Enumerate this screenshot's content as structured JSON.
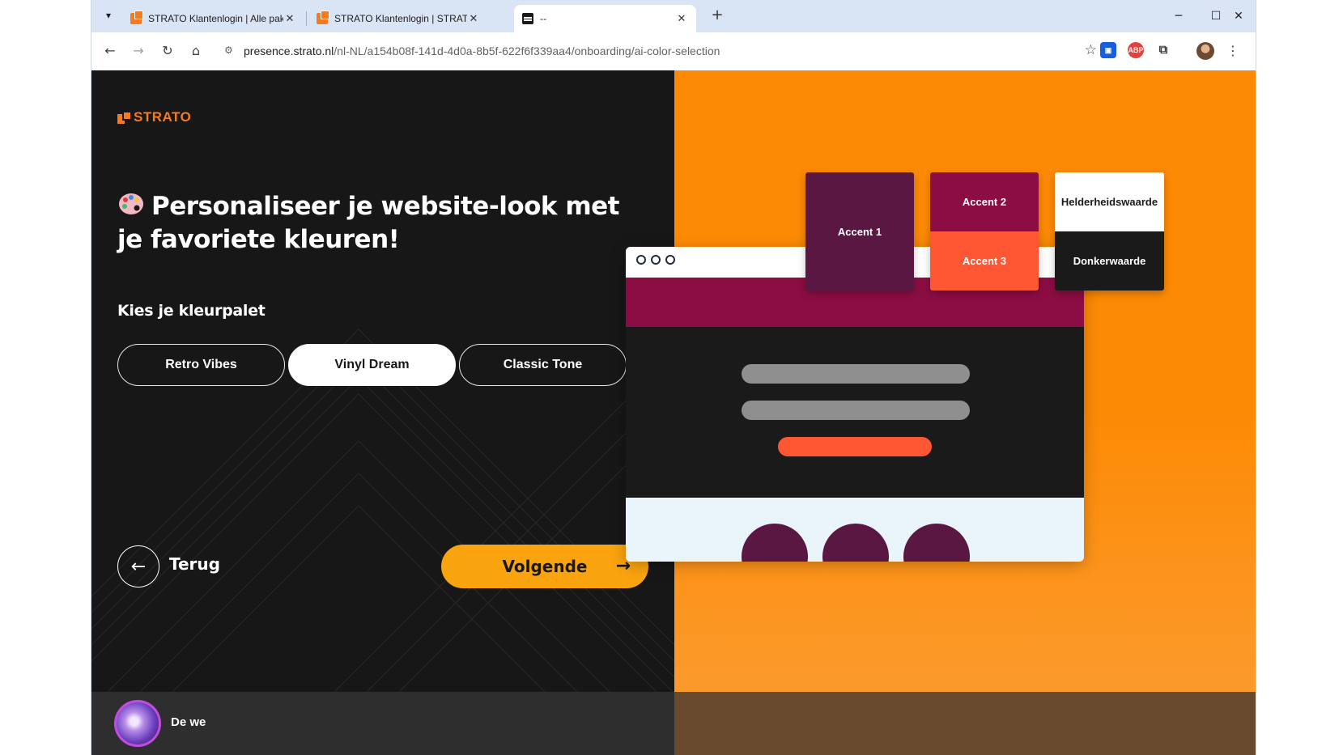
{
  "browser": {
    "tabs": [
      {
        "title": "STRATO Klantenlogin | Alle pakketten",
        "favicon": "strato-favicon",
        "active": false
      },
      {
        "title": "STRATO Klantenlogin | STRATO",
        "favicon": "strato-favicon",
        "active": false
      },
      {
        "title": "--",
        "favicon": "page-favicon",
        "active": true
      }
    ],
    "url_host": "presence.strato.nl",
    "url_path": "/nl-NL/a154b08f-141d-4d0a-8b5f-622f6f339aa4/onboarding/ai-color-selection",
    "extensions": [
      {
        "name": "bitwarden-icon",
        "label": "",
        "color": "#175ddc"
      },
      {
        "name": "adblock-plus-icon",
        "label": "ABP",
        "color": "#e5403d"
      }
    ],
    "window_controls": {
      "minimize": "─",
      "maximize": "☐",
      "close": "✕"
    }
  },
  "brand": {
    "logo_text": "STRATO",
    "accent": "#f47b20"
  },
  "onboarding": {
    "heading": "Personaliseer je website-look met je favoriete kleuren!",
    "heading_icon": "palette-emoji",
    "palette_label": "Kies je kleurpalet",
    "palettes": [
      {
        "label": "Retro Vibes",
        "selected": false
      },
      {
        "label": "Vinyl Dream",
        "selected": true
      },
      {
        "label": "Classic Tone",
        "selected": false
      }
    ],
    "back_label": "Terug",
    "next_label": "Volgende",
    "next_color": "#f9a30f"
  },
  "preview": {
    "background": "#fd8a05",
    "swatches": {
      "accent1": {
        "label": "Accent 1",
        "color": "#5a1742"
      },
      "accent2": {
        "label": "Accent 2",
        "color": "#8c0d43"
      },
      "accent3": {
        "label": "Accent 3",
        "color": "#ff5733"
      },
      "light": {
        "label": "Helderheidswaarde",
        "color": "#ffffff"
      },
      "dark": {
        "label": "Donkerwaarde",
        "color": "#1a1a1a"
      }
    }
  },
  "assistant": {
    "text": "De we"
  }
}
